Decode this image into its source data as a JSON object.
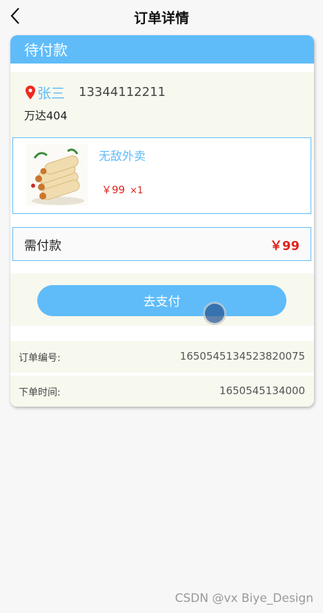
{
  "nav": {
    "title": "订单详情",
    "back_icon": "chevron-left-icon"
  },
  "order": {
    "status": "待付款",
    "address": {
      "name": "张三",
      "phone": "13344112211",
      "detail": "万达404",
      "icon": "location-pin-icon"
    },
    "item": {
      "name": "无敌外卖",
      "price": "￥99",
      "qty": "×1",
      "image": "food-thumbnail"
    },
    "payable": {
      "label": "需付款",
      "amount": "￥99"
    },
    "pay_button": "去支付",
    "order_no": {
      "label": "订单编号:",
      "value": "1650545134523820075"
    },
    "order_time": {
      "label": "下单时间:",
      "value": "1650545134000"
    }
  },
  "watermark": "CSDN @vx  Biye_Design",
  "colors": {
    "accent": "#5fbcf9",
    "price": "#e0231f",
    "panel": "#f7f8ee"
  }
}
